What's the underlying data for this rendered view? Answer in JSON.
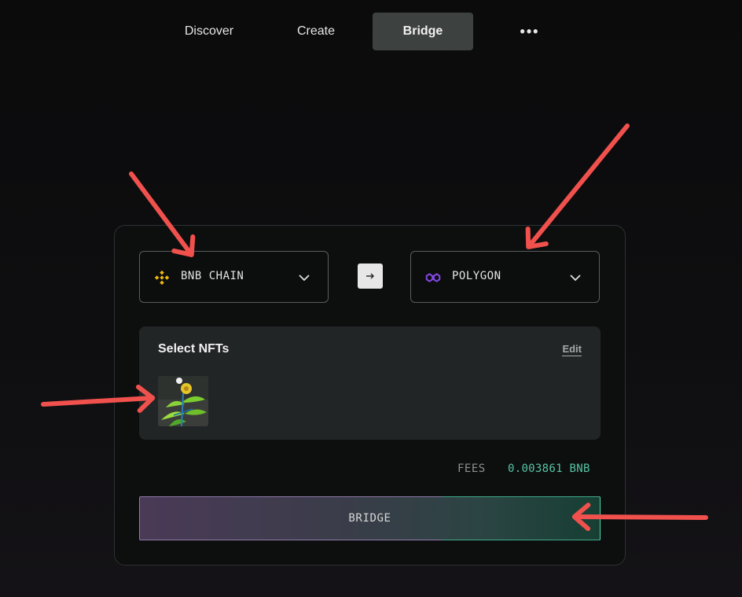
{
  "nav": {
    "items": [
      {
        "label": "Discover"
      },
      {
        "label": "Create"
      },
      {
        "label": "Bridge"
      },
      {
        "label": "•••"
      }
    ]
  },
  "bridge_card": {
    "from_chain": {
      "label": "BNB CHAIN",
      "icon": "bnb-chain-icon",
      "color": "#f0b90b"
    },
    "to_chain": {
      "label": "POLYGON",
      "icon": "polygon-icon",
      "color": "#8247e5"
    },
    "swap_icon": "arrow-right-icon",
    "nft_panel": {
      "title": "Select NFTs",
      "edit_label": "Edit",
      "nft_image": "nft-thumbnail-plant"
    },
    "fees": {
      "label": "FEES",
      "value": "0.003861 BNB",
      "value_color": "#55c4a2"
    },
    "bridge_button": {
      "label": "BRIDGE"
    }
  },
  "annotation_color": "#f0514d"
}
